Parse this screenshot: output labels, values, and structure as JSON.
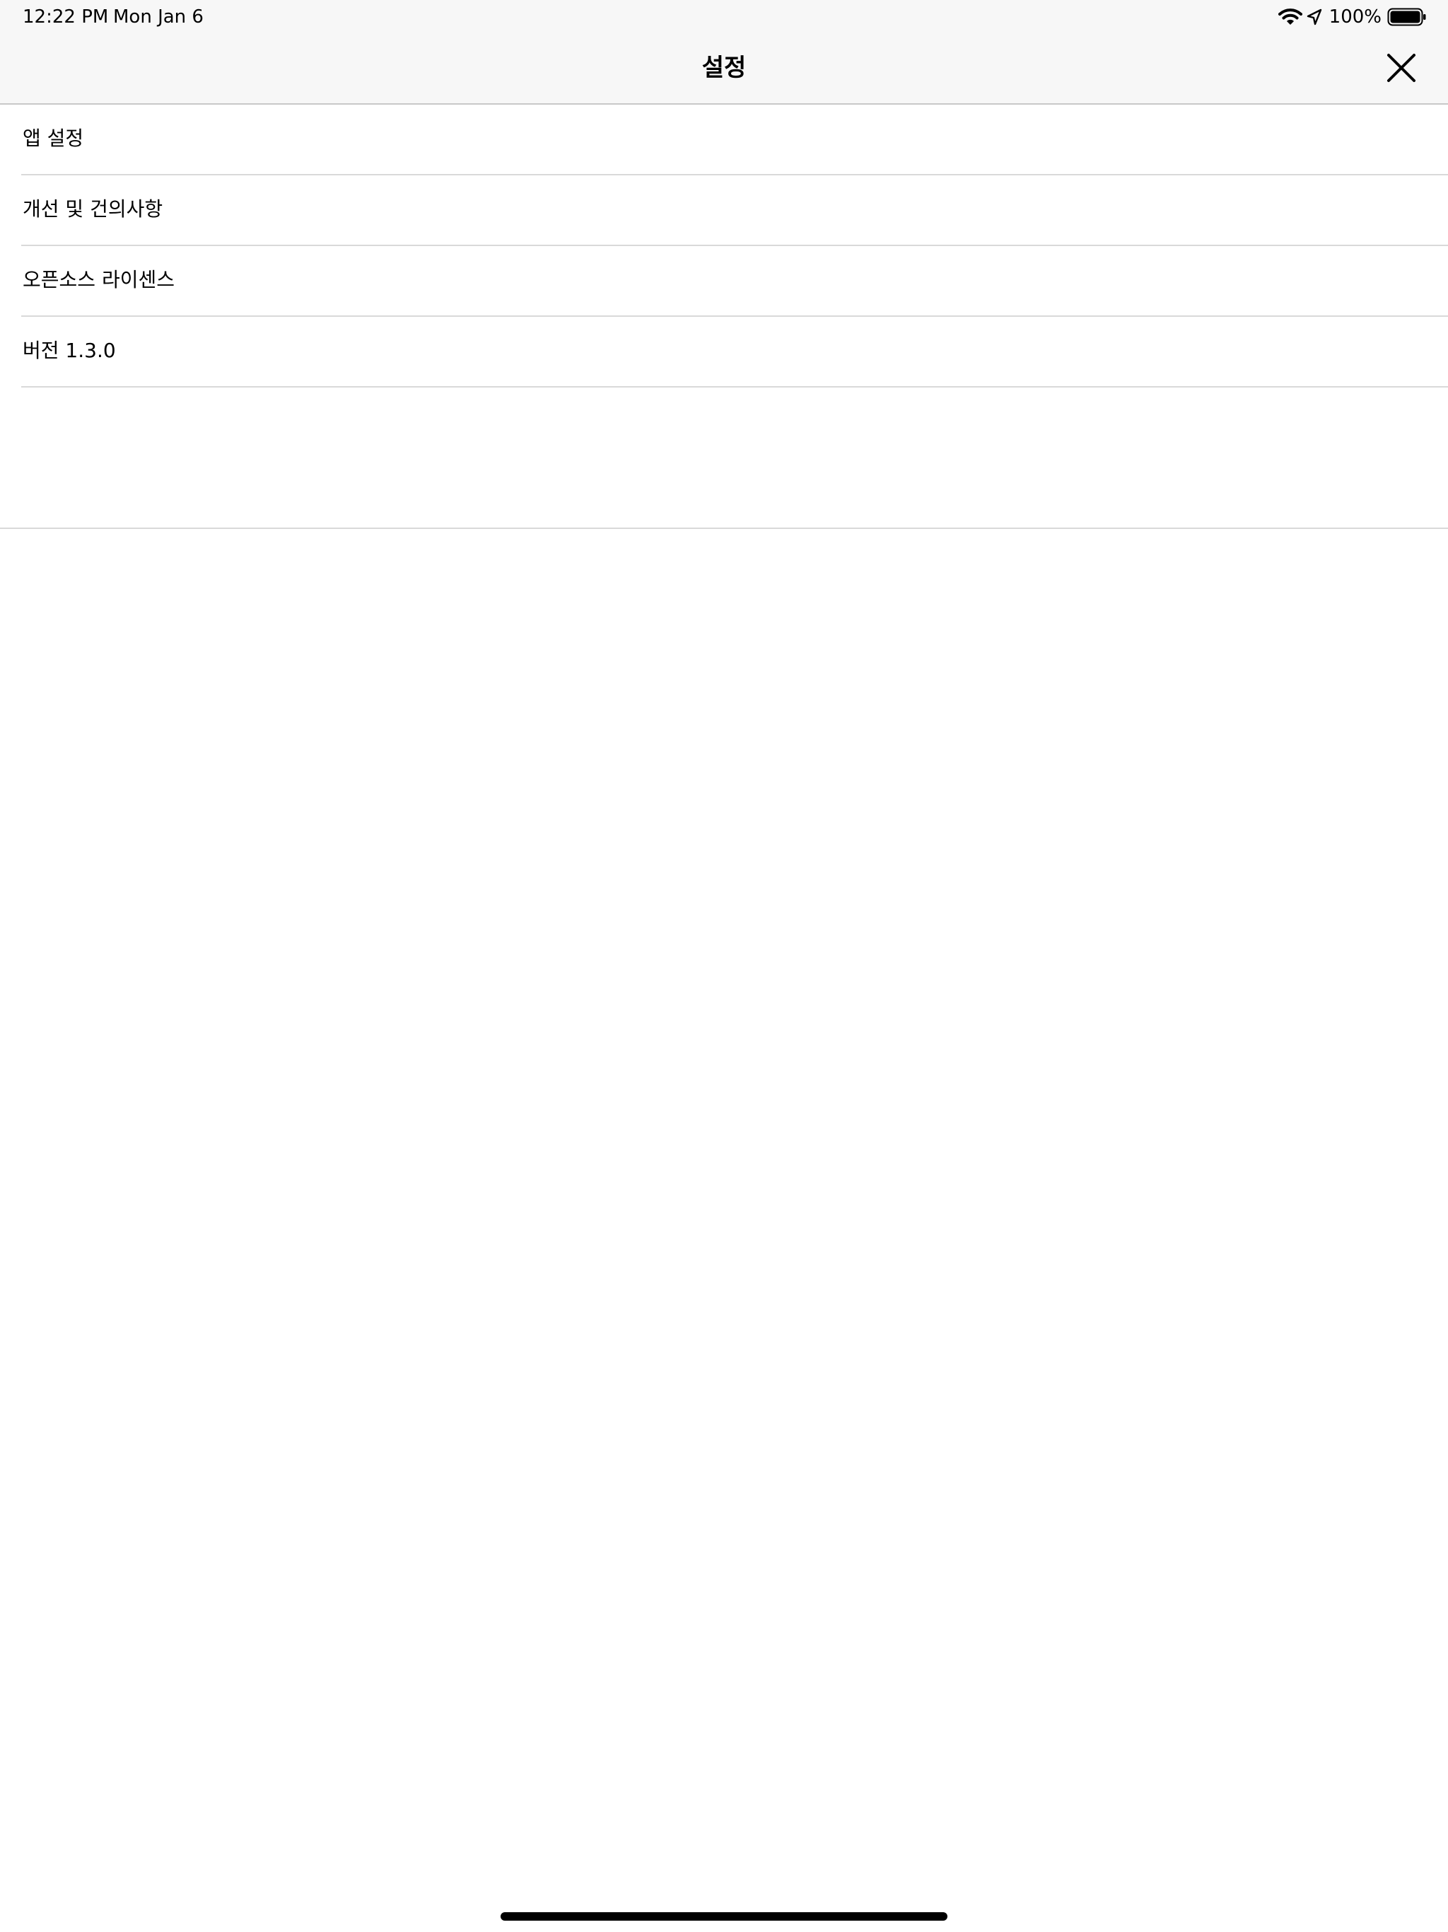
{
  "status_bar": {
    "time": "12:22 PM",
    "date": "Mon Jan 6",
    "battery_percent": "100%",
    "battery_level": 1.0,
    "icons": [
      "wifi-icon",
      "location-arrow-icon",
      "battery-icon"
    ]
  },
  "nav_bar": {
    "title": "설정",
    "close_icon": "close-icon"
  },
  "settings": {
    "items": [
      {
        "label": "앱 설정"
      },
      {
        "label": "개선 및 건의사항"
      },
      {
        "label": "오픈소스 라이센스"
      },
      {
        "label": "버전 1.3.0"
      }
    ]
  },
  "colors": {
    "bar_background": "#f7f7f7",
    "page_background": "#ffffff",
    "separator": "#d9d9d9",
    "text": "#000000"
  }
}
